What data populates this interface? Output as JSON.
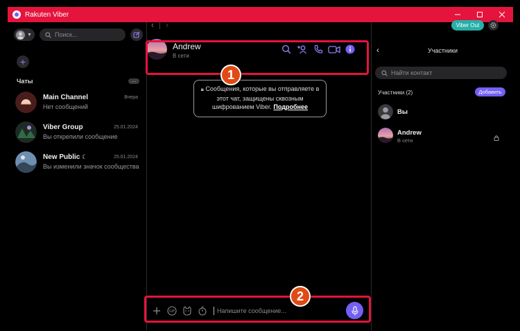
{
  "window": {
    "title": "Rakuten Viber"
  },
  "sidebar": {
    "search_placeholder": "Поиск...",
    "chats_label": "Чаты",
    "chats_more": "...",
    "chats": [
      {
        "name": "Main Channel",
        "preview": "Нет сообщений",
        "time": "Вчера"
      },
      {
        "name": "Viber Group",
        "preview": "Вы открепили сообщение",
        "time": "25.01.2024"
      },
      {
        "name": "New Public",
        "preview": "Вы изменили значок сообщества",
        "time": "25.01.2024"
      }
    ]
  },
  "topbar": {
    "viber_out_label": "Viber Out"
  },
  "chat_header": {
    "name": "Andrew",
    "status": "В сети"
  },
  "encryption_notice": {
    "text": "Сообщения, которые вы отправляете в этот чат, защищены сквозным шифрованием Viber.",
    "link": "Подробнее"
  },
  "composer": {
    "placeholder": "Напишите сообщение..."
  },
  "members_panel": {
    "title": "Участники",
    "search_placeholder": "Найти контакт",
    "members_label": "Участники (2)",
    "add_label": "Добавить",
    "members": [
      {
        "name": "Вы",
        "status": ""
      },
      {
        "name": "Andrew",
        "status": "В сети"
      }
    ]
  },
  "annotations": [
    {
      "label": "1"
    },
    {
      "label": "2"
    }
  ],
  "colors": {
    "titlebar": "#e4143c",
    "accent": "#7360f2",
    "viber_out": "#27b0a9",
    "annotation": "#e04a14"
  }
}
